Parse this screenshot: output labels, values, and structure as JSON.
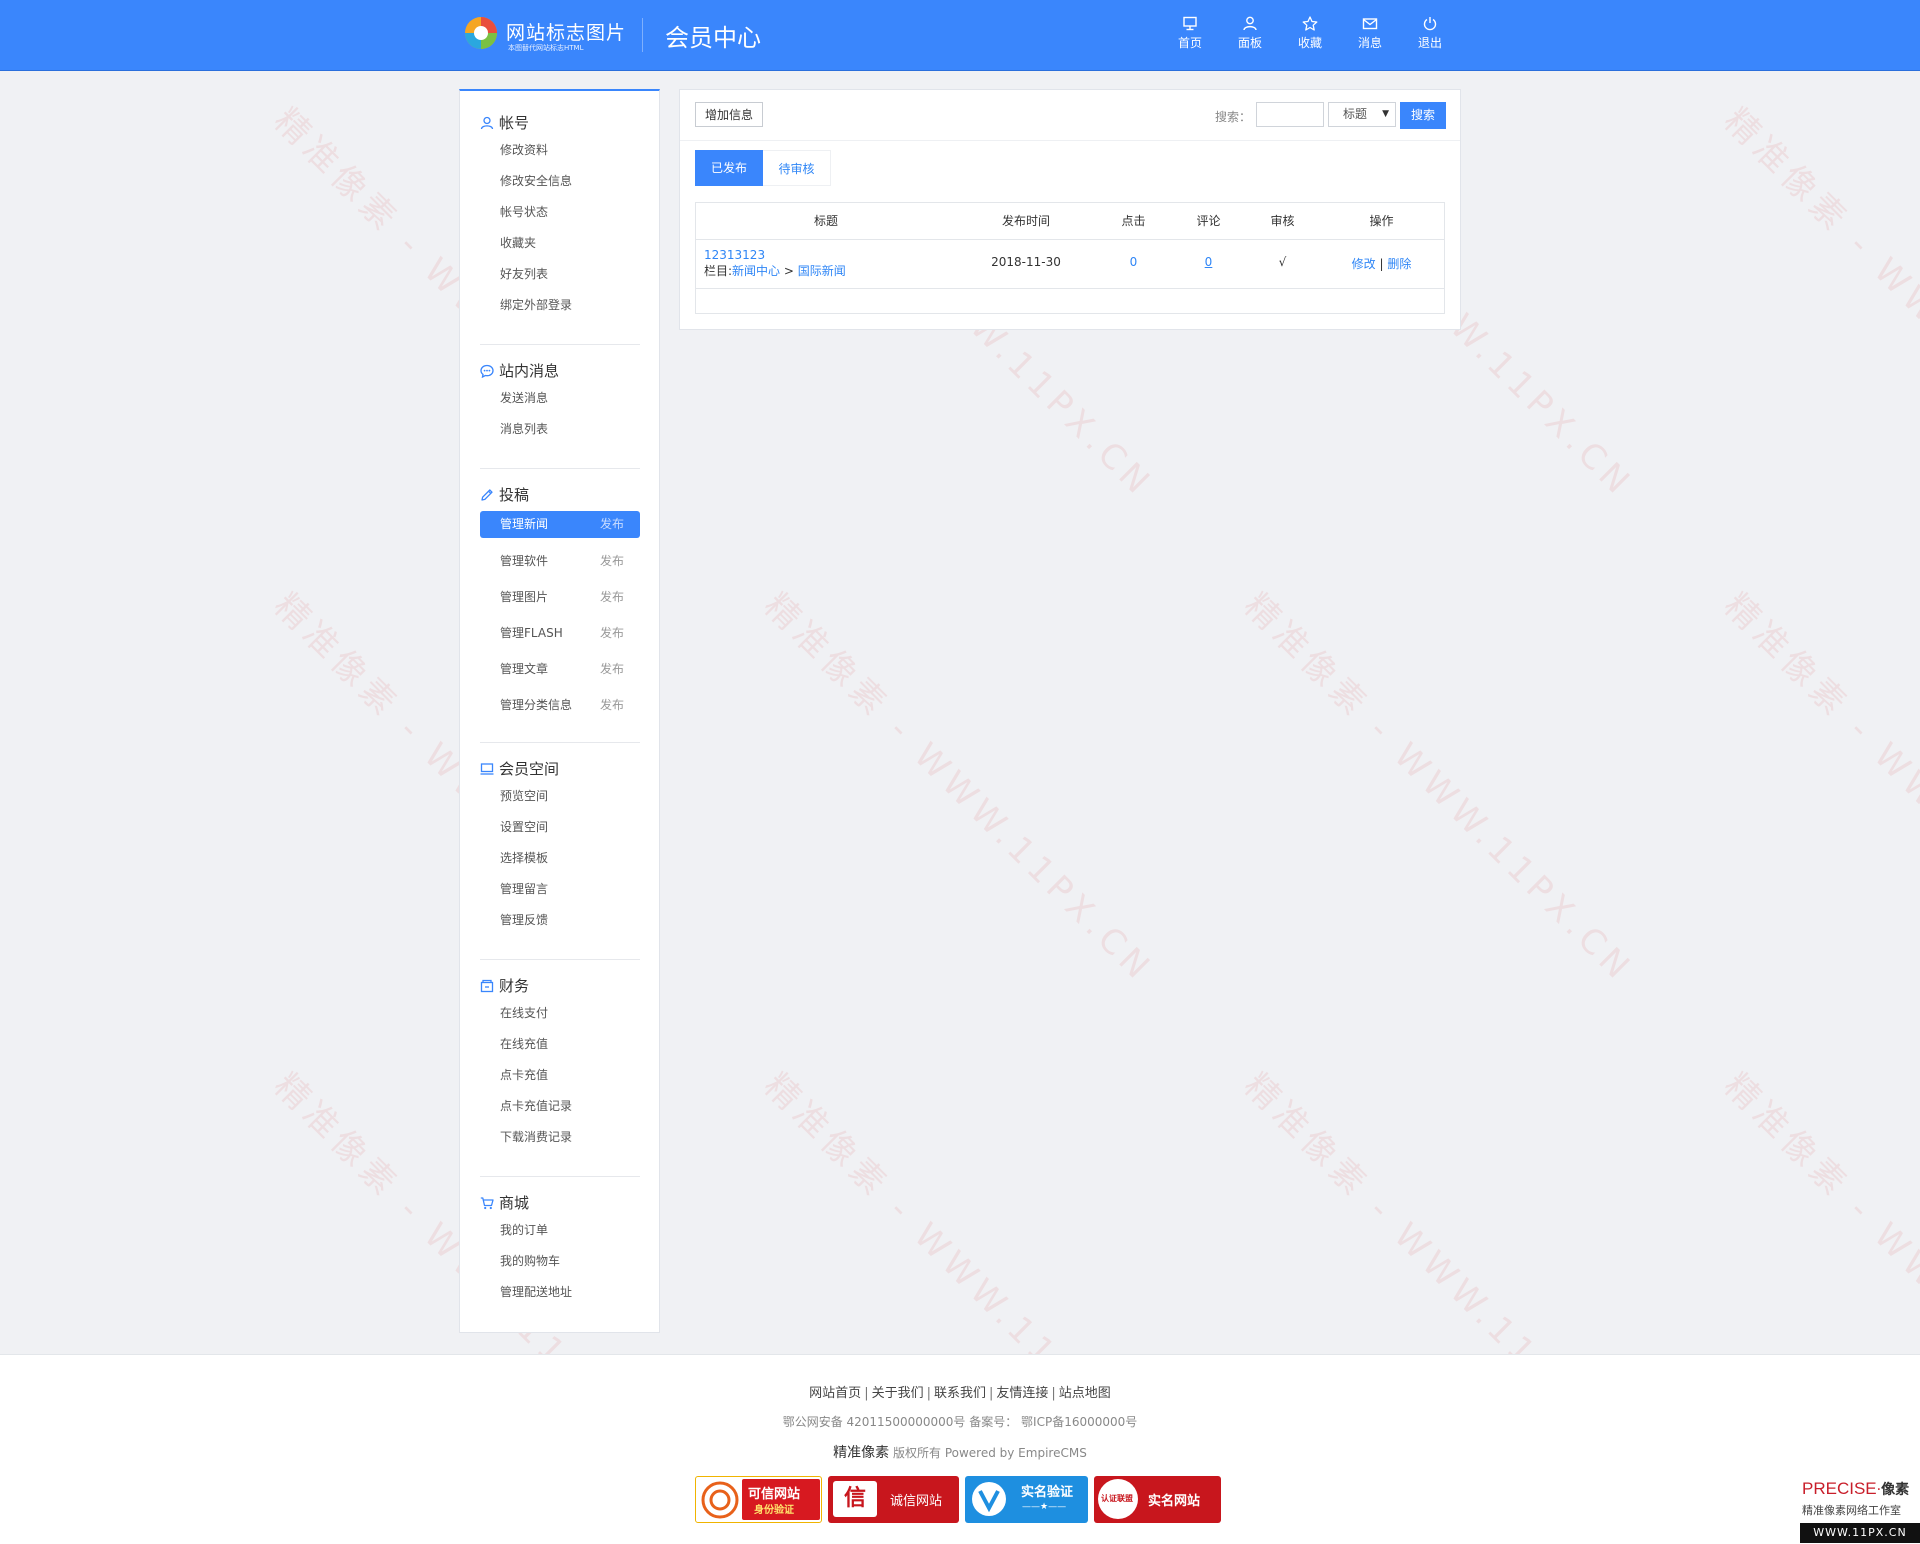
{
  "header": {
    "logo_title": "网站标志图片",
    "logo_sub": "本图替代网站标志HTML",
    "title": "会员中心",
    "nav": [
      {
        "label": "首页",
        "icon": "monitor-icon"
      },
      {
        "label": "面板",
        "icon": "user-icon"
      },
      {
        "label": "收藏",
        "icon": "star-icon"
      },
      {
        "label": "消息",
        "icon": "envelope-icon"
      },
      {
        "label": "退出",
        "icon": "power-icon"
      }
    ]
  },
  "sidebar": {
    "account": {
      "title": "帐号",
      "items": [
        "修改资料",
        "修改安全信息",
        "帐号状态",
        "收藏夹",
        "好友列表",
        "绑定外部登录"
      ]
    },
    "messages": {
      "title": "站内消息",
      "items": [
        "发送消息",
        "消息列表"
      ]
    },
    "submit": {
      "title": "投稿",
      "publish_label": "发布",
      "items": [
        "管理新闻",
        "管理软件",
        "管理图片",
        "管理FLASH",
        "管理文章",
        "管理分类信息"
      ],
      "active": "管理新闻"
    },
    "space": {
      "title": "会员空间",
      "items": [
        "预览空间",
        "设置空间",
        "选择模板",
        "管理留言",
        "管理反馈"
      ]
    },
    "finance": {
      "title": "财务",
      "items": [
        "在线支付",
        "在线充值",
        "点卡充值",
        "点卡充值记录",
        "下载消费记录"
      ]
    },
    "shop": {
      "title": "商城",
      "items": [
        "我的订单",
        "我的购物车",
        "管理配送地址"
      ]
    }
  },
  "main": {
    "add_button": "增加信息",
    "search_label": "搜索：",
    "search_value": "",
    "search_field_selected": "标题",
    "search_button": "搜索",
    "tabs": [
      "已发布",
      "待审核"
    ],
    "active_tab": "已发布",
    "table": {
      "headers": [
        "标题",
        "发布时间",
        "点击",
        "评论",
        "审核",
        "操作"
      ],
      "rows": [
        {
          "title": "12313123",
          "category_prefix": "栏目:",
          "category_parent": "新闻中心",
          "category_sep": ">",
          "category_child": "国际新闻",
          "date": "2018-11-30",
          "clicks": "0",
          "comments": "0",
          "approved": "√",
          "edit": "修改",
          "action_sep": "|",
          "delete": "删除"
        }
      ]
    }
  },
  "footer": {
    "links": [
      "网站首页",
      "关于我们",
      "联系我们",
      "友情连接",
      "站点地图"
    ],
    "link_sep": "|",
    "icp": "鄂公网安备 42011500000000号 备案号： 鄂ICP备16000000号",
    "brand": "精准像素",
    "copyright": "版权所有 Powered by EmpireCMS",
    "badges": [
      {
        "main": "可信网站",
        "sub": "身份验证",
        "color": "#d71920"
      },
      {
        "main": "诚信网站",
        "sub": "",
        "color": "#c8161d"
      },
      {
        "main": "实名验证",
        "sub": "——★——",
        "color": "#1e8fe0"
      },
      {
        "main": "实名网站",
        "sub": "认证联盟",
        "color": "#c8161d"
      }
    ]
  },
  "watermark": {
    "text": "精准像素 - WWW.11PX.CN"
  },
  "corner": {
    "brand_en": "PRECISE",
    "brand_cn": "像素",
    "studio": "精准像素网络工作室",
    "url": "WWW.11PX.CN"
  },
  "colors": {
    "primary": "#3a86fc",
    "link": "#2f86f6",
    "background": "#f0f1f4"
  }
}
